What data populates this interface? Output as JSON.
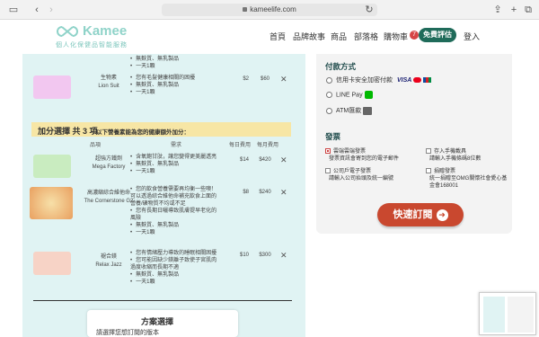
{
  "browser": {
    "url": "kameelife.com"
  },
  "brand": {
    "name": "Kamee",
    "tagline": "個人化保健品智能服務",
    "color": "#8fd3c9"
  },
  "nav": {
    "items": [
      "首頁",
      "品牌故事",
      "商品",
      "部落格",
      "購物車"
    ],
    "cart_count": "7",
    "trial": "免費評估",
    "login": "登入"
  },
  "top_product": {
    "needs_partial": [
      "無麩質、無乳製品",
      "一天1顆"
    ]
  },
  "product_lion": {
    "name": "生物素\nLion Suit",
    "needs": [
      "您有毛髮健康相關的困擾",
      "無麩質、無乳製品",
      "一天1顆"
    ],
    "price_day": "$2",
    "price_month": "$60"
  },
  "addon": {
    "title": "加分選擇 共 3 項",
    "subtitle": "以下營養素能為您的健康額外加分："
  },
  "table_headers": {
    "item": "品項",
    "needs": "需求",
    "daily": "每日費用",
    "monthly": "每月費用"
  },
  "addons": [
    {
      "name": "超強方鐵劑\nMega Factory",
      "needs": [
        "含氧飽甘肽，讓您變得更美麗透亮",
        "無麩質、無乳製品",
        "一天1顆"
      ],
      "price_day": "$14",
      "price_month": "$420"
    },
    {
      "name": "高濃縮綜合維他命\nThe Cornerstone G2",
      "needs": [
        "您的飲食營養需要再均衡一些噢！可以透過綜合維他命補充飲食上面的營養/礦物質不均或不足",
        "您有長期日曬導致肌膚提早老化的風險",
        "無麩質、無乳製品",
        "一天1顆"
      ],
      "price_day": "$8",
      "price_month": "$240"
    },
    {
      "name": "褪合鎂\nRelax Jazz",
      "needs": [
        "您有情緒壓力導致的睡眠相關困擾",
        "您可能因缺少鎂離子致使子宮肌肉過度收縮而長期不適",
        "無麩質、無乳製品",
        "一天1顆"
      ],
      "price_day": "$10",
      "price_month": "$300"
    }
  ],
  "plan": {
    "title": "方案選擇",
    "subtitle": "請選擇您想訂閱的版本"
  },
  "payment": {
    "title": "付款方式",
    "options": [
      "信用卡安全加密付款",
      "LINE Pay",
      "ATM匯款"
    ],
    "selected": 0
  },
  "invoice": {
    "title": "發票",
    "options": [
      {
        "label": "雲端雲端發票",
        "desc": "發票資訊會寄到您的電子郵件"
      },
      {
        "label": "存入手機載具",
        "desc": "請輸入手機條碼8位數"
      },
      {
        "label": "公司戶電子發票",
        "desc": "請輸入公司抬頭及統一編號"
      },
      {
        "label": "捐贈發票",
        "desc": "統一捐贈至OMG關懷社會愛心基金會168001"
      }
    ]
  },
  "subscribe_button": "快速訂閱",
  "colors": {
    "accent": "#c9482f",
    "dark_green": "#1f6b5a",
    "panel_blue": "#e0f3f3",
    "addon_yellow": "#f7e6a5"
  }
}
